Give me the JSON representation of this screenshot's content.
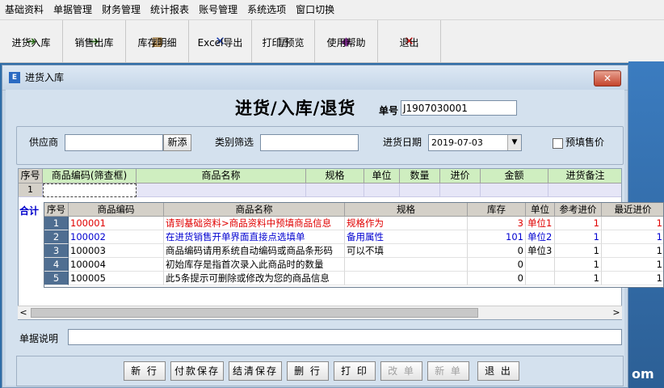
{
  "menu": [
    "基础资料",
    "单据管理",
    "财务管理",
    "统计报表",
    "账号管理",
    "系统选项",
    "窗口切换"
  ],
  "toolbar": [
    {
      "label": "进货入库",
      "icon": "stock-in-icon",
      "glyph": "➔",
      "color": "#2c6b1a"
    },
    {
      "label": "销售出库",
      "icon": "stock-out-icon",
      "glyph": "➔",
      "color": "#2c6b1a"
    },
    {
      "label": "库存明细",
      "icon": "inventory-icon",
      "glyph": "▦",
      "color": "#8a5a10"
    },
    {
      "label": "Excel导出",
      "icon": "excel-export-icon",
      "glyph": "✕",
      "color": "#1a3ca8"
    },
    {
      "label": "打印/预览",
      "icon": "print-icon",
      "glyph": "▤",
      "color": "#444444"
    },
    {
      "label": "使用帮助",
      "icon": "help-book-icon",
      "glyph": "◆",
      "color": "#7a2a8a"
    },
    {
      "label": "退出",
      "icon": "exit-x-icon",
      "glyph": "✕",
      "color": "#d01010"
    }
  ],
  "window": {
    "title": "进货入库",
    "close": "✕"
  },
  "form": {
    "heading": "进货/入库/退货",
    "doc_no_label": "单号",
    "doc_no": "J1907030001",
    "supplier_label": "供应商",
    "supplier_value": "",
    "add_button": "新添",
    "category_label": "类别筛选",
    "category_value": "",
    "date_label": "进货日期",
    "date_value": "2019-07-03",
    "prefill_label": "预填售价",
    "memo_label": "单据说明",
    "total_label": "合计"
  },
  "grid": {
    "columns": [
      "序号",
      "商品编码(筛查框)",
      "商品名称",
      "规格",
      "单位",
      "数量",
      "进价",
      "金额",
      "进货备注"
    ],
    "first_row_no": "1"
  },
  "popup": {
    "columns": [
      "序号",
      "商品编码",
      "商品名称",
      "规格",
      "库存",
      "单位",
      "参考进价",
      "最近进价"
    ],
    "rows": [
      {
        "no": "1",
        "code": "100001",
        "name": "请到基础资料>商品资料中预填商品信息",
        "spec": "规格作为",
        "stock": "3",
        "unit": "单位1",
        "ref": "1",
        "last": "1",
        "color": "#e00000"
      },
      {
        "no": "2",
        "code": "100002",
        "name": "在进货销售开单界面直接点选填单",
        "spec": "备用属性",
        "stock": "101",
        "unit": "单位2",
        "ref": "1",
        "last": "1",
        "color": "#0000d0"
      },
      {
        "no": "3",
        "code": "100003",
        "name": "商品编码请用系统自动编码或商品条形码",
        "spec": "可以不填",
        "stock": "0",
        "unit": "单位3",
        "ref": "1",
        "last": "1",
        "color": "#000000"
      },
      {
        "no": "4",
        "code": "100004",
        "name": "初始库存是指首次录入此商品时的数量",
        "spec": "",
        "stock": "0",
        "unit": "",
        "ref": "1",
        "last": "1",
        "color": "#000000"
      },
      {
        "no": "5",
        "code": "100005",
        "name": "此5条提示可删除或修改为您的商品信息",
        "spec": "",
        "stock": "0",
        "unit": "",
        "ref": "1",
        "last": "1",
        "color": "#000000"
      }
    ]
  },
  "actions": [
    {
      "label": "新 行",
      "enabled": true
    },
    {
      "label": "付款保存",
      "enabled": true
    },
    {
      "label": "结清保存",
      "enabled": true
    },
    {
      "label": "删 行",
      "enabled": true
    },
    {
      "label": "打 印",
      "enabled": true
    },
    {
      "label": "改 单",
      "enabled": false
    },
    {
      "label": "新 单",
      "enabled": false
    },
    {
      "label": "退 出",
      "enabled": true
    }
  ],
  "desktop_text": "om"
}
